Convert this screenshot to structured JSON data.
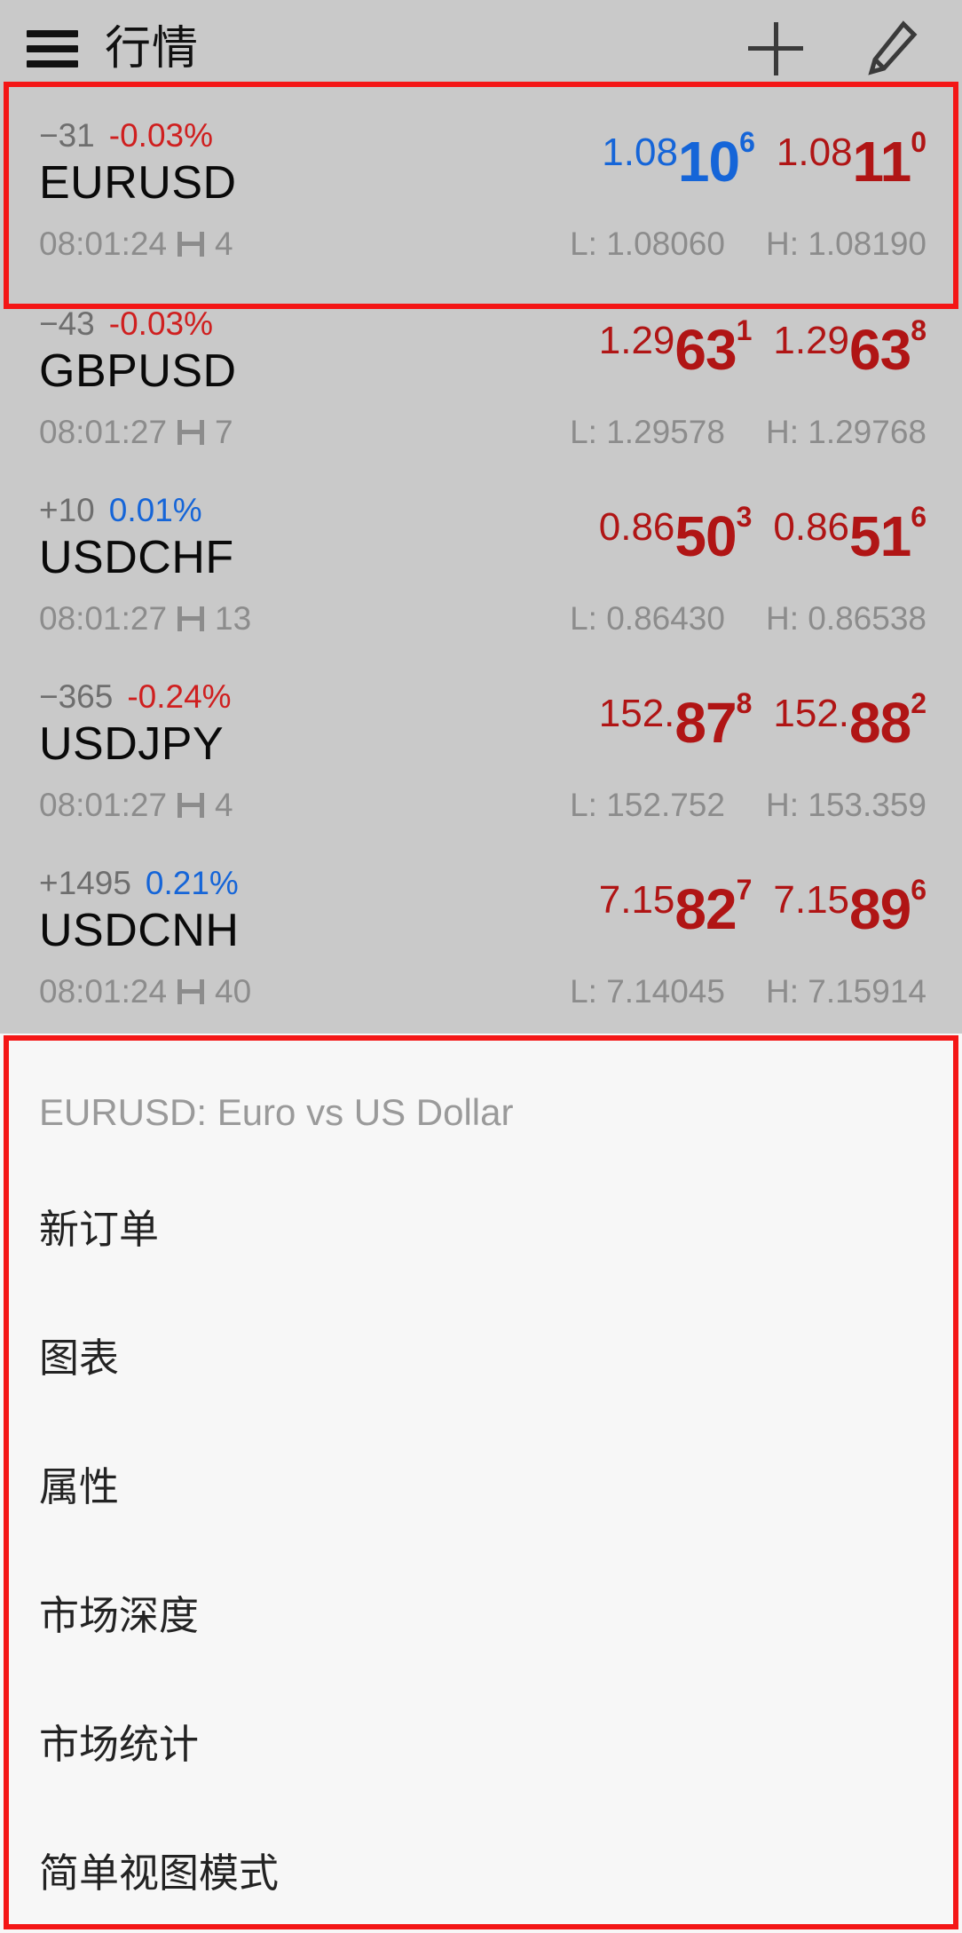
{
  "header": {
    "title": "行情",
    "menu_icon": "hamburger-icon",
    "add_icon": "plus-icon",
    "edit_icon": "pencil-icon"
  },
  "colors": {
    "bid_blue": "#1565d8",
    "ask_red": "#b01515",
    "negative": "#cf1f1f",
    "positive": "#1565d8",
    "highlight": "#f41616",
    "list_bg": "#c9c9c9",
    "menu_bg": "#f7f7f7"
  },
  "quotes": [
    {
      "change": "−31",
      "percent": "-0.03%",
      "percent_dir": "neg",
      "symbol": "EURUSD",
      "time": "08:01:24",
      "spread": "4",
      "bid": {
        "small": "1.08",
        "big": "10",
        "sup": "6",
        "color": "bid-blue"
      },
      "ask": {
        "small": "1.08",
        "big": "11",
        "sup": "0",
        "color": "ask-red"
      },
      "low": "L: 1.08060",
      "high": "H: 1.08190",
      "selected": true
    },
    {
      "change": "−43",
      "percent": "-0.03%",
      "percent_dir": "neg",
      "symbol": "GBPUSD",
      "time": "08:01:27",
      "spread": "7",
      "bid": {
        "small": "1.29",
        "big": "63",
        "sup": "1",
        "color": "bid-red"
      },
      "ask": {
        "small": "1.29",
        "big": "63",
        "sup": "8",
        "color": "ask-red"
      },
      "low": "L: 1.29578",
      "high": "H: 1.29768",
      "selected": false
    },
    {
      "change": "+10",
      "percent": "0.01%",
      "percent_dir": "pos",
      "symbol": "USDCHF",
      "time": "08:01:27",
      "spread": "13",
      "bid": {
        "small": "0.86",
        "big": "50",
        "sup": "3",
        "color": "bid-red"
      },
      "ask": {
        "small": "0.86",
        "big": "51",
        "sup": "6",
        "color": "ask-red"
      },
      "low": "L: 0.86430",
      "high": "H: 0.86538",
      "selected": false
    },
    {
      "change": "−365",
      "percent": "-0.24%",
      "percent_dir": "neg",
      "symbol": "USDJPY",
      "time": "08:01:27",
      "spread": "4",
      "bid": {
        "small": "152.",
        "big": "87",
        "sup": "8",
        "color": "bid-red"
      },
      "ask": {
        "small": "152.",
        "big": "88",
        "sup": "2",
        "color": "ask-red"
      },
      "low": "L: 152.752",
      "high": "H: 153.359",
      "selected": false
    },
    {
      "change": "+1495",
      "percent": "0.21%",
      "percent_dir": "pos",
      "symbol": "USDCNH",
      "time": "08:01:24",
      "spread": "40",
      "bid": {
        "small": "7.15",
        "big": "82",
        "sup": "7",
        "color": "bid-red"
      },
      "ask": {
        "small": "7.15",
        "big": "89",
        "sup": "6",
        "color": "ask-red"
      },
      "low": "L: 7.14045",
      "high": "H: 7.15914",
      "selected": false
    }
  ],
  "context_menu": {
    "title": "EURUSD: Euro vs US Dollar",
    "items": [
      {
        "label": "新订单"
      },
      {
        "label": "图表"
      },
      {
        "label": "属性"
      },
      {
        "label": "市场深度"
      },
      {
        "label": "市场统计"
      },
      {
        "label": "简单视图模式"
      }
    ]
  }
}
